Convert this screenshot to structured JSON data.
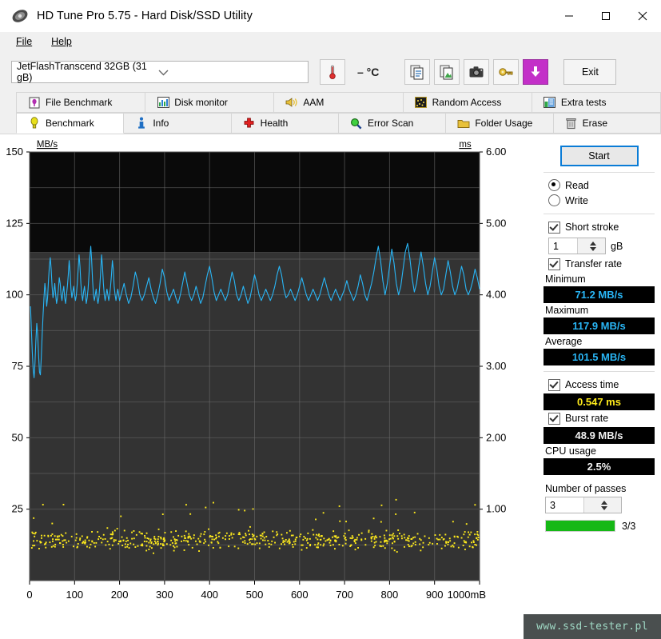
{
  "window": {
    "title": "HD Tune Pro 5.75 - Hard Disk/SSD Utility",
    "minimize": "─",
    "maximize": "□",
    "close": "✕"
  },
  "menu": {
    "items": [
      "File",
      "Help"
    ]
  },
  "toolbar": {
    "drive": "JetFlashTranscend 32GB (31 gB)",
    "drive_chevron": "⌄",
    "temperature": "– °C",
    "exit_label": "Exit",
    "icons": [
      "thermometer-icon",
      "copy-icon",
      "copy-image-icon",
      "camera-icon",
      "key-icon",
      "download-icon"
    ]
  },
  "tabs": {
    "row1": [
      {
        "label": "File Benchmark",
        "icon": "file-benchmark-icon",
        "active": false
      },
      {
        "label": "Disk monitor",
        "icon": "disk-monitor-icon",
        "active": false
      },
      {
        "label": "AAM",
        "icon": "aam-speaker-icon",
        "active": false
      },
      {
        "label": "Random Access",
        "icon": "random-access-icon",
        "active": false
      },
      {
        "label": "Extra tests",
        "icon": "extra-tests-icon",
        "active": false
      }
    ],
    "row2": [
      {
        "label": "Benchmark",
        "icon": "benchmark-bulb-icon",
        "active": true
      },
      {
        "label": "Info",
        "icon": "info-icon",
        "active": false
      },
      {
        "label": "Health",
        "icon": "health-cross-icon",
        "active": false
      },
      {
        "label": "Error Scan",
        "icon": "error-scan-magnifier-icon",
        "active": false
      },
      {
        "label": "Folder Usage",
        "icon": "folder-usage-icon",
        "active": false
      },
      {
        "label": "Erase",
        "icon": "erase-trash-icon",
        "active": false
      }
    ]
  },
  "panel": {
    "start_label": "Start",
    "mode": {
      "read_label": "Read",
      "write_label": "Write",
      "selected": "Read"
    },
    "short_stroke": {
      "label": "Short stroke",
      "checked": true,
      "value": "1",
      "unit": "gB"
    },
    "transfer_rate": {
      "label": "Transfer rate",
      "checked": true
    },
    "minimum": {
      "label": "Minimum",
      "value": "71.2 MB/s"
    },
    "maximum": {
      "label": "Maximum",
      "value": "117.9 MB/s"
    },
    "average": {
      "label": "Average",
      "value": "101.5 MB/s"
    },
    "access_time": {
      "label": "Access time",
      "checked": true,
      "value": "0.547 ms"
    },
    "burst_rate": {
      "label": "Burst rate",
      "checked": true,
      "value": "48.9 MB/s"
    },
    "cpu_usage": {
      "label": "CPU usage",
      "value": "2.5%"
    },
    "passes": {
      "label": "Number of passes",
      "value": "3",
      "progress_text": "3/3",
      "progress_percent": 100
    }
  },
  "watermark": "www.ssd-tester.pl",
  "chart_data": {
    "type": "line",
    "title": "",
    "xlabel": "1000mB",
    "ylabel": "MB/s",
    "y2label": "ms",
    "xlim": [
      0,
      1000
    ],
    "ylim": [
      0,
      150
    ],
    "y2lim": [
      0,
      6
    ],
    "grid": true,
    "legend_position": "none",
    "xticks": [
      0,
      100,
      200,
      300,
      400,
      500,
      600,
      700,
      800,
      900,
      1000
    ],
    "xticklabels": [
      "0",
      "100",
      "200",
      "300",
      "400",
      "500",
      "600",
      "700",
      "800",
      "900",
      "1000mB"
    ],
    "yticks": [
      25,
      50,
      75,
      100,
      125,
      150
    ],
    "yticklabels": [
      "25",
      "50",
      "75",
      "100",
      "125",
      "150"
    ],
    "y2ticks": [
      1,
      2,
      3,
      4,
      5,
      6
    ],
    "y2ticklabels": [
      "1.00",
      "2.00",
      "3.00",
      "4.00",
      "5.00",
      "6.00"
    ],
    "plot_bg_dark": "#0a0a0a",
    "plot_bg_light": "#333333",
    "bg_split_value": 115,
    "grid_color": "#6e6e6e",
    "series": [
      {
        "name": "Transfer rate",
        "type": "line",
        "color": "#29b6f6",
        "axis": "left",
        "units": "MB/s",
        "x": [
          2,
          4,
          6,
          8,
          10,
          12,
          14,
          16,
          18,
          20,
          22,
          24,
          26,
          28,
          30,
          32,
          34,
          36,
          38,
          40,
          42,
          44,
          46,
          48,
          50,
          52,
          54,
          56,
          58,
          60,
          62,
          64,
          66,
          68,
          70,
          72,
          74,
          76,
          78,
          80,
          82,
          84,
          86,
          88,
          90,
          92,
          94,
          96,
          98,
          100,
          102,
          104,
          106,
          108,
          110,
          112,
          114,
          116,
          118,
          120,
          122,
          124,
          126,
          128,
          130,
          132,
          134,
          136,
          138,
          140,
          142,
          144,
          146,
          148,
          150,
          152,
          154,
          156,
          158,
          160,
          162,
          164,
          166,
          168,
          170,
          172,
          174,
          176,
          178,
          180,
          182,
          184,
          186,
          188,
          190,
          192,
          194,
          196,
          198,
          200,
          205,
          210,
          215,
          220,
          225,
          230,
          235,
          240,
          245,
          250,
          255,
          260,
          265,
          270,
          275,
          280,
          285,
          290,
          295,
          300,
          305,
          310,
          315,
          320,
          325,
          330,
          335,
          340,
          345,
          350,
          355,
          360,
          365,
          370,
          375,
          380,
          385,
          390,
          395,
          400,
          405,
          410,
          415,
          420,
          425,
          430,
          435,
          440,
          445,
          450,
          455,
          460,
          465,
          470,
          475,
          480,
          485,
          490,
          495,
          500,
          505,
          510,
          515,
          520,
          525,
          530,
          535,
          540,
          545,
          550,
          555,
          560,
          565,
          570,
          575,
          580,
          585,
          590,
          595,
          600,
          605,
          610,
          615,
          620,
          625,
          630,
          635,
          640,
          645,
          650,
          655,
          660,
          665,
          670,
          675,
          680,
          685,
          690,
          695,
          700,
          705,
          710,
          715,
          720,
          725,
          730,
          735,
          740,
          745,
          750,
          755,
          760,
          765,
          770,
          775,
          780,
          785,
          790,
          795,
          800,
          805,
          810,
          815,
          820,
          825,
          830,
          835,
          840,
          845,
          850,
          855,
          860,
          865,
          870,
          875,
          880,
          885,
          890,
          895,
          900,
          905,
          910,
          915,
          920,
          925,
          930,
          935,
          940,
          945,
          950,
          955,
          960,
          965,
          970,
          975,
          980,
          985,
          990,
          995,
          1000
        ],
        "y": [
          96,
          88,
          80,
          74,
          71,
          76,
          84,
          90,
          86,
          79,
          73,
          72,
          78,
          86,
          93,
          99,
          104,
          101,
          96,
          99,
          105,
          110,
          113,
          109,
          103,
          99,
          101,
          104,
          100,
          97,
          99,
          102,
          106,
          104,
          100,
          98,
          101,
          103,
          99,
          97,
          100,
          103,
          107,
          112,
          108,
          102,
          99,
          101,
          103,
          100,
          98,
          100,
          104,
          109,
          114,
          110,
          104,
          100,
          98,
          101,
          103,
          100,
          97,
          99,
          102,
          107,
          113,
          117,
          112,
          105,
          100,
          98,
          100,
          102,
          99,
          97,
          99,
          103,
          108,
          114,
          110,
          104,
          100,
          98,
          100,
          102,
          100,
          98,
          100,
          103,
          107,
          112,
          109,
          103,
          100,
          98,
          100,
          102,
          100,
          98,
          101,
          104,
          100,
          97,
          99,
          103,
          108,
          105,
          100,
          98,
          100,
          103,
          106,
          102,
          99,
          97,
          100,
          104,
          109,
          106,
          101,
          98,
          100,
          102,
          99,
          97,
          100,
          104,
          108,
          104,
          100,
          98,
          100,
          103,
          100,
          97,
          99,
          103,
          107,
          110,
          106,
          101,
          98,
          100,
          102,
          100,
          98,
          100,
          104,
          108,
          105,
          100,
          98,
          100,
          103,
          100,
          97,
          99,
          103,
          107,
          104,
          100,
          98,
          100,
          102,
          100,
          98,
          100,
          103,
          107,
          110,
          107,
          102,
          99,
          100,
          102,
          100,
          98,
          100,
          103,
          106,
          103,
          100,
          98,
          100,
          102,
          100,
          98,
          100,
          103,
          106,
          103,
          100,
          98,
          100,
          102,
          100,
          98,
          100,
          102,
          105,
          102,
          100,
          98,
          100,
          103,
          107,
          104,
          100,
          98,
          101,
          104,
          108,
          113,
          117,
          112,
          105,
          100,
          104,
          110,
          116,
          111,
          104,
          100,
          103,
          109,
          115,
          118,
          113,
          106,
          101,
          104,
          110,
          115,
          110,
          104,
          100,
          103,
          108,
          113,
          109,
          103,
          100,
          102,
          107,
          112,
          108,
          103,
          100,
          102,
          106,
          110,
          107,
          102,
          100,
          102,
          105,
          109,
          106,
          102,
          100,
          102,
          105,
          108,
          105,
          101,
          99,
          101,
          104,
          107,
          104,
          101,
          99,
          101,
          103,
          106,
          103,
          101
        ]
      },
      {
        "name": "Access time",
        "type": "scatter",
        "color": "#ffeb1c",
        "axis": "right",
        "units": "ms",
        "mean": 0.547,
        "spread": [
          0.38,
          0.78
        ],
        "outlier_range": [
          0.8,
          1.15
        ],
        "point_count": 620
      }
    ]
  }
}
